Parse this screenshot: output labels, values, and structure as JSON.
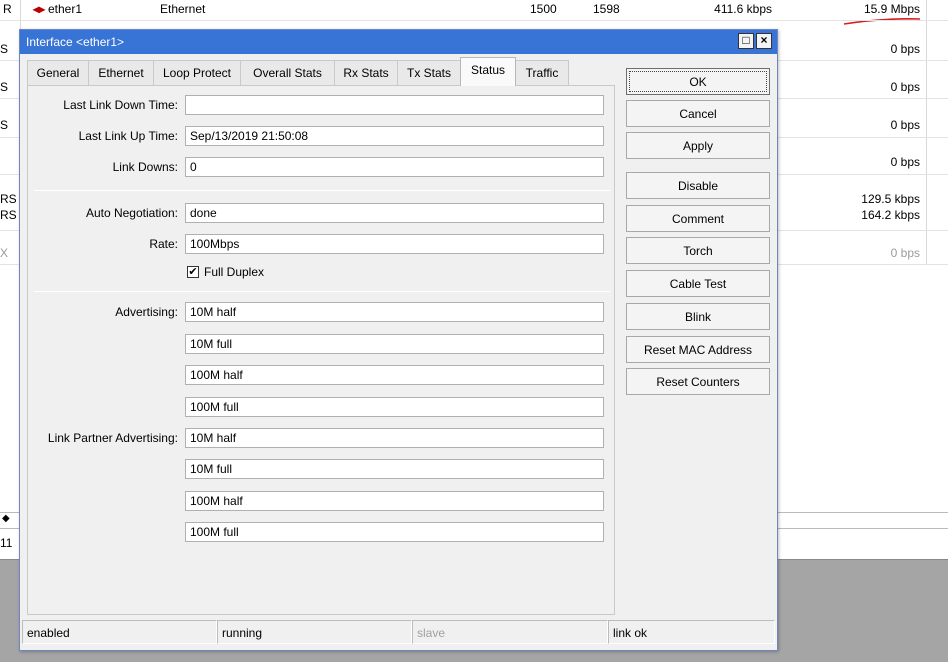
{
  "background_table": {
    "top_row": {
      "flag": "R",
      "name": "ether1",
      "type": "Ethernet",
      "mtu": "1500",
      "actual_mtu": "1598",
      "tx": "411.6 kbps",
      "rx": "15.9 Mbps"
    },
    "left_flags": [
      "S",
      "S",
      "S",
      "RS",
      "RS",
      "X"
    ],
    "rx_values": [
      "0 bps",
      "0 bps",
      "0 bps",
      "0 bps",
      "129.5 kbps",
      "164.2 kbps",
      "0 bps"
    ],
    "bottom_left": "11",
    "scroll_arrow": "◆"
  },
  "dialog": {
    "title": "Interface <ether1>",
    "restore_glyph": "□",
    "close_glyph": "×",
    "tabs": [
      "General",
      "Ethernet",
      "Loop Protect",
      "Overall Stats",
      "Rx Stats",
      "Tx Stats",
      "Status",
      "Traffic"
    ],
    "active_tab": "Status",
    "status": {
      "last_link_down_time_label": "Last Link Down Time:",
      "last_link_down_time": "",
      "last_link_up_time_label": "Last Link Up Time:",
      "last_link_up_time": "Sep/13/2019 21:50:08",
      "link_downs_label": "Link Downs:",
      "link_downs": "0",
      "auto_negotiation_label": "Auto Negotiation:",
      "auto_negotiation": "done",
      "rate_label": "Rate:",
      "rate": "100Mbps",
      "full_duplex_label": "Full Duplex",
      "full_duplex_checked": "✔",
      "advertising_label": "Advertising:",
      "advertising": [
        "10M half",
        "10M full",
        "100M half",
        "100M full"
      ],
      "link_partner_advertising_label": "Link Partner Advertising:",
      "link_partner_advertising": [
        "10M half",
        "10M full",
        "100M half",
        "100M full"
      ]
    },
    "buttons": [
      "OK",
      "Cancel",
      "Apply",
      "Disable",
      "Comment",
      "Torch",
      "Cable Test",
      "Blink",
      "Reset MAC Address",
      "Reset Counters"
    ],
    "statusbar": [
      "enabled",
      "running",
      "slave",
      "link ok"
    ]
  },
  "colors": {
    "titlebar": "#3873d6",
    "annotation_red": "#d21f1f"
  }
}
